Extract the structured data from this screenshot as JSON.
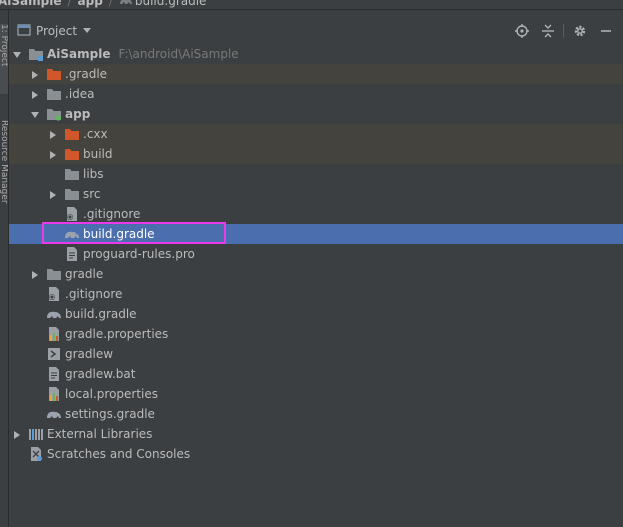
{
  "breadcrumb": {
    "items": [
      "AiSample",
      "app",
      "build.gradle"
    ]
  },
  "side_tabs": {
    "project": "1: Project",
    "resource_manager": "Resource Manager"
  },
  "toolbar": {
    "view_label": "Project",
    "icons": [
      "locate-icon",
      "collapse-all-icon",
      "gear-icon",
      "minimize-icon"
    ]
  },
  "tree": {
    "root": {
      "label": "AiSample",
      "path": "F:\\android\\AiSample"
    },
    "items": [
      {
        "label": ".gradle"
      },
      {
        "label": ".idea"
      },
      {
        "label": "app"
      },
      {
        "label": ".cxx"
      },
      {
        "label": "build"
      },
      {
        "label": "libs"
      },
      {
        "label": "src"
      },
      {
        "label": ".gitignore"
      },
      {
        "label": "build.gradle"
      },
      {
        "label": "proguard-rules.pro"
      },
      {
        "label": "gradle"
      },
      {
        "label": ".gitignore"
      },
      {
        "label": "build.gradle"
      },
      {
        "label": "gradle.properties"
      },
      {
        "label": "gradlew"
      },
      {
        "label": "gradlew.bat"
      },
      {
        "label": "local.properties"
      },
      {
        "label": "settings.gradle"
      },
      {
        "label": "External Libraries"
      },
      {
        "label": "Scratches and Consoles"
      }
    ]
  },
  "colors": {
    "background": "#3c3f41",
    "selection": "#4b6eaf",
    "excluded_row": "#45433d",
    "highlight_box": "#e83ae8",
    "folder_excluded": "#d1572b",
    "folder": "#8a8f94"
  }
}
